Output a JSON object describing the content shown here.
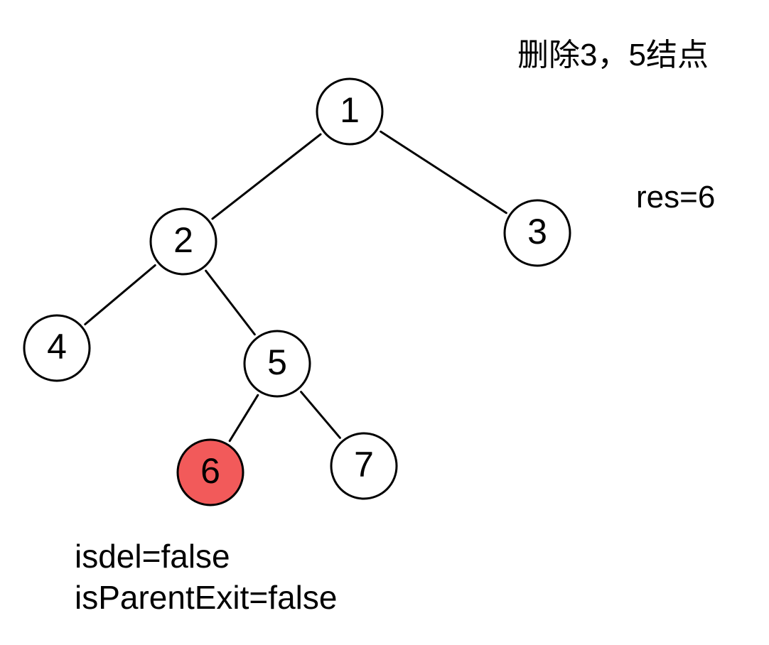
{
  "title": "删除3，5结点",
  "res_text": "res=6",
  "flags": {
    "isdel": "isdel=false",
    "isParentExit": "isParentExit=false"
  },
  "colors": {
    "node_fill": "#ffffff",
    "highlight_fill": "#f25a5a",
    "stroke": "#000000"
  },
  "tree": {
    "nodes": [
      {
        "id": "1",
        "label": "1",
        "highlighted": false
      },
      {
        "id": "2",
        "label": "2",
        "highlighted": false
      },
      {
        "id": "3",
        "label": "3",
        "highlighted": false
      },
      {
        "id": "4",
        "label": "4",
        "highlighted": false
      },
      {
        "id": "5",
        "label": "5",
        "highlighted": false
      },
      {
        "id": "6",
        "label": "6",
        "highlighted": true
      },
      {
        "id": "7",
        "label": "7",
        "highlighted": false
      }
    ],
    "edges": [
      {
        "from": "1",
        "to": "2"
      },
      {
        "from": "1",
        "to": "3"
      },
      {
        "from": "2",
        "to": "4"
      },
      {
        "from": "2",
        "to": "5"
      },
      {
        "from": "5",
        "to": "6"
      },
      {
        "from": "5",
        "to": "7"
      }
    ]
  }
}
